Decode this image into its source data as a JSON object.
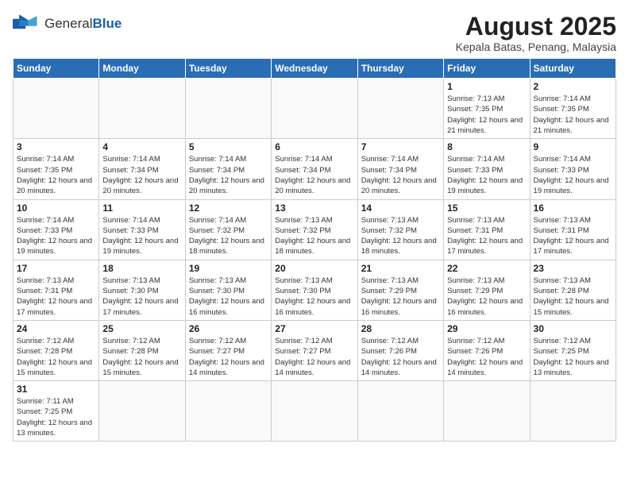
{
  "header": {
    "logo_general": "General",
    "logo_blue": "Blue",
    "month_title": "August 2025",
    "location": "Kepala Batas, Penang, Malaysia"
  },
  "weekdays": [
    "Sunday",
    "Monday",
    "Tuesday",
    "Wednesday",
    "Thursday",
    "Friday",
    "Saturday"
  ],
  "weeks": [
    [
      {
        "day": "",
        "info": ""
      },
      {
        "day": "",
        "info": ""
      },
      {
        "day": "",
        "info": ""
      },
      {
        "day": "",
        "info": ""
      },
      {
        "day": "",
        "info": ""
      },
      {
        "day": "1",
        "info": "Sunrise: 7:13 AM\nSunset: 7:35 PM\nDaylight: 12 hours and 21 minutes."
      },
      {
        "day": "2",
        "info": "Sunrise: 7:14 AM\nSunset: 7:35 PM\nDaylight: 12 hours and 21 minutes."
      }
    ],
    [
      {
        "day": "3",
        "info": "Sunrise: 7:14 AM\nSunset: 7:35 PM\nDaylight: 12 hours and 20 minutes."
      },
      {
        "day": "4",
        "info": "Sunrise: 7:14 AM\nSunset: 7:34 PM\nDaylight: 12 hours and 20 minutes."
      },
      {
        "day": "5",
        "info": "Sunrise: 7:14 AM\nSunset: 7:34 PM\nDaylight: 12 hours and 20 minutes."
      },
      {
        "day": "6",
        "info": "Sunrise: 7:14 AM\nSunset: 7:34 PM\nDaylight: 12 hours and 20 minutes."
      },
      {
        "day": "7",
        "info": "Sunrise: 7:14 AM\nSunset: 7:34 PM\nDaylight: 12 hours and 20 minutes."
      },
      {
        "day": "8",
        "info": "Sunrise: 7:14 AM\nSunset: 7:33 PM\nDaylight: 12 hours and 19 minutes."
      },
      {
        "day": "9",
        "info": "Sunrise: 7:14 AM\nSunset: 7:33 PM\nDaylight: 12 hours and 19 minutes."
      }
    ],
    [
      {
        "day": "10",
        "info": "Sunrise: 7:14 AM\nSunset: 7:33 PM\nDaylight: 12 hours and 19 minutes."
      },
      {
        "day": "11",
        "info": "Sunrise: 7:14 AM\nSunset: 7:33 PM\nDaylight: 12 hours and 19 minutes."
      },
      {
        "day": "12",
        "info": "Sunrise: 7:14 AM\nSunset: 7:32 PM\nDaylight: 12 hours and 18 minutes."
      },
      {
        "day": "13",
        "info": "Sunrise: 7:13 AM\nSunset: 7:32 PM\nDaylight: 12 hours and 18 minutes."
      },
      {
        "day": "14",
        "info": "Sunrise: 7:13 AM\nSunset: 7:32 PM\nDaylight: 12 hours and 18 minutes."
      },
      {
        "day": "15",
        "info": "Sunrise: 7:13 AM\nSunset: 7:31 PM\nDaylight: 12 hours and 17 minutes."
      },
      {
        "day": "16",
        "info": "Sunrise: 7:13 AM\nSunset: 7:31 PM\nDaylight: 12 hours and 17 minutes."
      }
    ],
    [
      {
        "day": "17",
        "info": "Sunrise: 7:13 AM\nSunset: 7:31 PM\nDaylight: 12 hours and 17 minutes."
      },
      {
        "day": "18",
        "info": "Sunrise: 7:13 AM\nSunset: 7:30 PM\nDaylight: 12 hours and 17 minutes."
      },
      {
        "day": "19",
        "info": "Sunrise: 7:13 AM\nSunset: 7:30 PM\nDaylight: 12 hours and 16 minutes."
      },
      {
        "day": "20",
        "info": "Sunrise: 7:13 AM\nSunset: 7:30 PM\nDaylight: 12 hours and 16 minutes."
      },
      {
        "day": "21",
        "info": "Sunrise: 7:13 AM\nSunset: 7:29 PM\nDaylight: 12 hours and 16 minutes."
      },
      {
        "day": "22",
        "info": "Sunrise: 7:13 AM\nSunset: 7:29 PM\nDaylight: 12 hours and 16 minutes."
      },
      {
        "day": "23",
        "info": "Sunrise: 7:13 AM\nSunset: 7:28 PM\nDaylight: 12 hours and 15 minutes."
      }
    ],
    [
      {
        "day": "24",
        "info": "Sunrise: 7:12 AM\nSunset: 7:28 PM\nDaylight: 12 hours and 15 minutes."
      },
      {
        "day": "25",
        "info": "Sunrise: 7:12 AM\nSunset: 7:28 PM\nDaylight: 12 hours and 15 minutes."
      },
      {
        "day": "26",
        "info": "Sunrise: 7:12 AM\nSunset: 7:27 PM\nDaylight: 12 hours and 14 minutes."
      },
      {
        "day": "27",
        "info": "Sunrise: 7:12 AM\nSunset: 7:27 PM\nDaylight: 12 hours and 14 minutes."
      },
      {
        "day": "28",
        "info": "Sunrise: 7:12 AM\nSunset: 7:26 PM\nDaylight: 12 hours and 14 minutes."
      },
      {
        "day": "29",
        "info": "Sunrise: 7:12 AM\nSunset: 7:26 PM\nDaylight: 12 hours and 14 minutes."
      },
      {
        "day": "30",
        "info": "Sunrise: 7:12 AM\nSunset: 7:25 PM\nDaylight: 12 hours and 13 minutes."
      }
    ],
    [
      {
        "day": "31",
        "info": "Sunrise: 7:11 AM\nSunset: 7:25 PM\nDaylight: 12 hours and 13 minutes."
      },
      {
        "day": "",
        "info": ""
      },
      {
        "day": "",
        "info": ""
      },
      {
        "day": "",
        "info": ""
      },
      {
        "day": "",
        "info": ""
      },
      {
        "day": "",
        "info": ""
      },
      {
        "day": "",
        "info": ""
      }
    ]
  ]
}
